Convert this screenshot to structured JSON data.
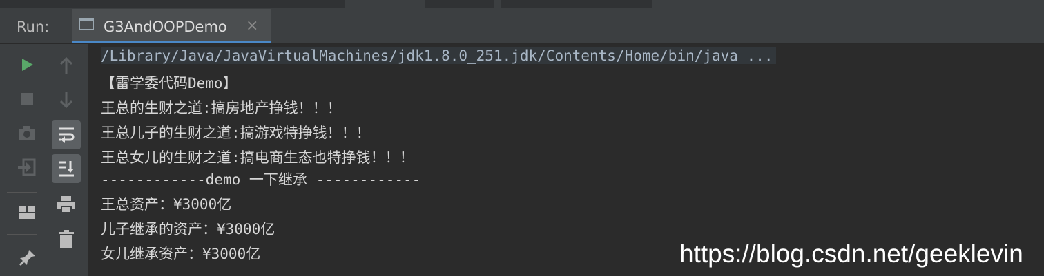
{
  "run_panel": {
    "label": "Run:",
    "tab_title": "G3AndOOPDemo",
    "tab_close": "×"
  },
  "toolbar": {
    "left": [
      "run-icon",
      "stop-icon",
      "camera-icon",
      "login-icon",
      "layout-icon",
      "pin-icon"
    ],
    "right": [
      "arrow-up-icon",
      "arrow-down-icon",
      "soft-wrap-icon",
      "scroll-to-end-icon",
      "print-icon",
      "trash-icon"
    ]
  },
  "console": {
    "lines": [
      "/Library/Java/JavaVirtualMachines/jdk1.8.0_251.jdk/Contents/Home/bin/java ...",
      "【雷学委代码Demo】",
      "王总的生财之道:搞房地产挣钱！！！",
      "王总儿子的生财之道:搞游戏特挣钱！！！",
      "王总女儿的生财之道:搞电商生态也特挣钱！！！",
      "------------demo 一下继承 ------------",
      "王总资产：¥3000亿",
      "儿子继承的资产：¥3000亿",
      "女儿继承资产：¥3000亿"
    ]
  },
  "watermark": "https://blog.csdn.net/geeklevin",
  "colors": {
    "background": "#2b2b2b",
    "toolbar": "#3c3f41",
    "run_green": "#59a869",
    "tab_underline": "#4a88c7"
  }
}
